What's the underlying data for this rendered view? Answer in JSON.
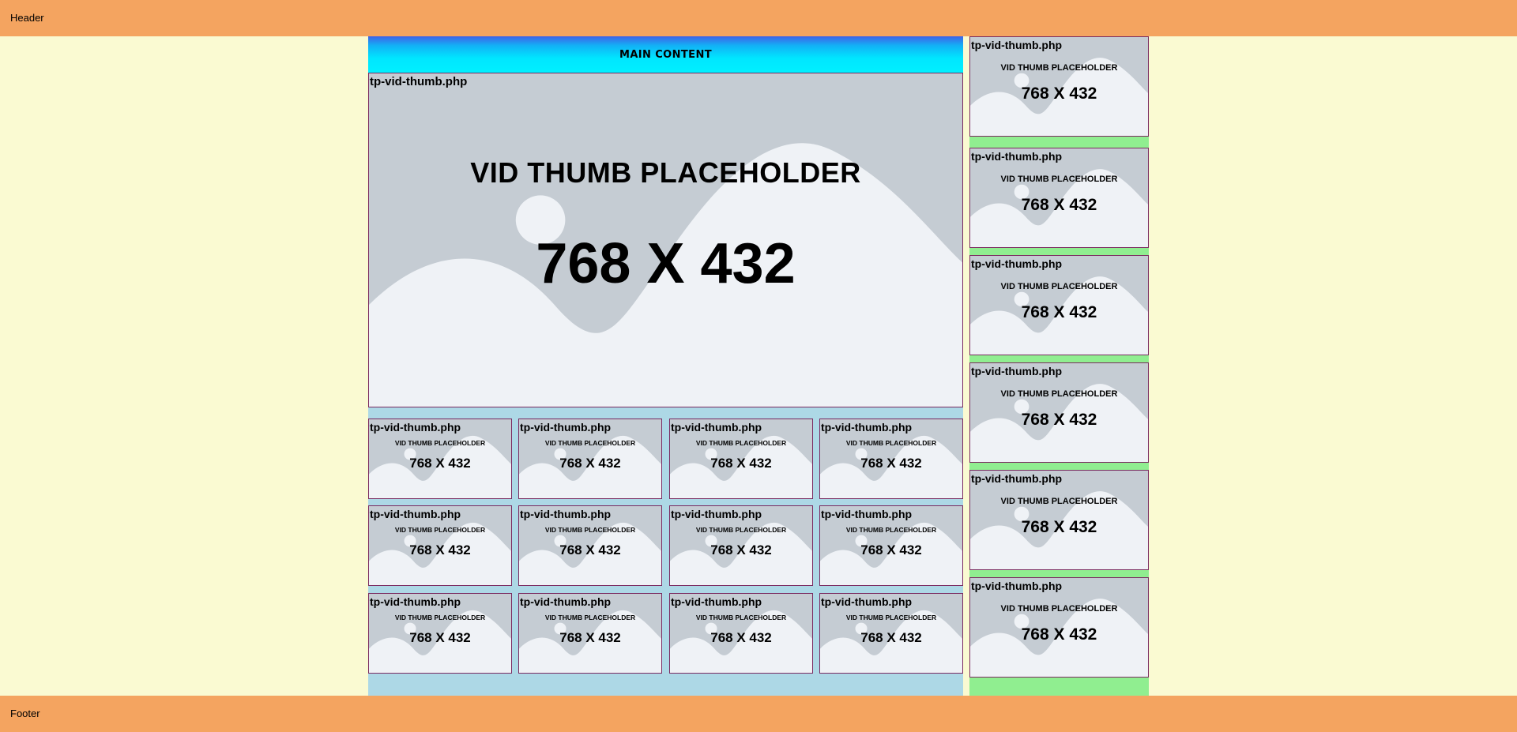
{
  "header": {
    "label": "Header"
  },
  "footer": {
    "label": "Footer"
  },
  "main": {
    "title": "MAIN CONTENT",
    "featured": {
      "filename": "tp-vid-thumb.php",
      "placeholder_title": "VID THUMB PLACEHOLDER",
      "placeholder_size": "768 X 432"
    },
    "grid": [
      {
        "filename": "tp-vid-thumb.php",
        "placeholder_title": "VID THUMB PLACEHOLDER",
        "placeholder_size": "768 X 432"
      },
      {
        "filename": "tp-vid-thumb.php",
        "placeholder_title": "VID THUMB PLACEHOLDER",
        "placeholder_size": "768 X 432"
      },
      {
        "filename": "tp-vid-thumb.php",
        "placeholder_title": "VID THUMB PLACEHOLDER",
        "placeholder_size": "768 X 432"
      },
      {
        "filename": "tp-vid-thumb.php",
        "placeholder_title": "VID THUMB PLACEHOLDER",
        "placeholder_size": "768 X 432"
      },
      {
        "filename": "tp-vid-thumb.php",
        "placeholder_title": "VID THUMB PLACEHOLDER",
        "placeholder_size": "768 X 432"
      },
      {
        "filename": "tp-vid-thumb.php",
        "placeholder_title": "VID THUMB PLACEHOLDER",
        "placeholder_size": "768 X 432"
      },
      {
        "filename": "tp-vid-thumb.php",
        "placeholder_title": "VID THUMB PLACEHOLDER",
        "placeholder_size": "768 X 432"
      },
      {
        "filename": "tp-vid-thumb.php",
        "placeholder_title": "VID THUMB PLACEHOLDER",
        "placeholder_size": "768 X 432"
      },
      {
        "filename": "tp-vid-thumb.php",
        "placeholder_title": "VID THUMB PLACEHOLDER",
        "placeholder_size": "768 X 432"
      },
      {
        "filename": "tp-vid-thumb.php",
        "placeholder_title": "VID THUMB PLACEHOLDER",
        "placeholder_size": "768 X 432"
      },
      {
        "filename": "tp-vid-thumb.php",
        "placeholder_title": "VID THUMB PLACEHOLDER",
        "placeholder_size": "768 X 432"
      },
      {
        "filename": "tp-vid-thumb.php",
        "placeholder_title": "VID THUMB PLACEHOLDER",
        "placeholder_size": "768 X 432"
      }
    ]
  },
  "sidebar": {
    "items": [
      {
        "filename": "tp-vid-thumb.php",
        "placeholder_title": "VID THUMB PLACEHOLDER",
        "placeholder_size": "768 X 432"
      },
      {
        "filename": "tp-vid-thumb.php",
        "placeholder_title": "VID THUMB PLACEHOLDER",
        "placeholder_size": "768 X 432"
      },
      {
        "filename": "tp-vid-thumb.php",
        "placeholder_title": "VID THUMB PLACEHOLDER",
        "placeholder_size": "768 X 432"
      },
      {
        "filename": "tp-vid-thumb.php",
        "placeholder_title": "VID THUMB PLACEHOLDER",
        "placeholder_size": "768 X 432"
      },
      {
        "filename": "tp-vid-thumb.php",
        "placeholder_title": "VID THUMB PLACEHOLDER",
        "placeholder_size": "768 X 432"
      },
      {
        "filename": "tp-vid-thumb.php",
        "placeholder_title": "VID THUMB PLACEHOLDER",
        "placeholder_size": "768 X 432"
      }
    ]
  },
  "colors": {
    "page_bg": "#fafad2",
    "header_footer_bg": "#f4a460",
    "main_bg": "#add8e6",
    "sidebar_bg": "#90ee90",
    "thumb_dark": "#c5ccd3",
    "thumb_light": "#eff2f6",
    "thumb_border": "#7a2a60"
  }
}
